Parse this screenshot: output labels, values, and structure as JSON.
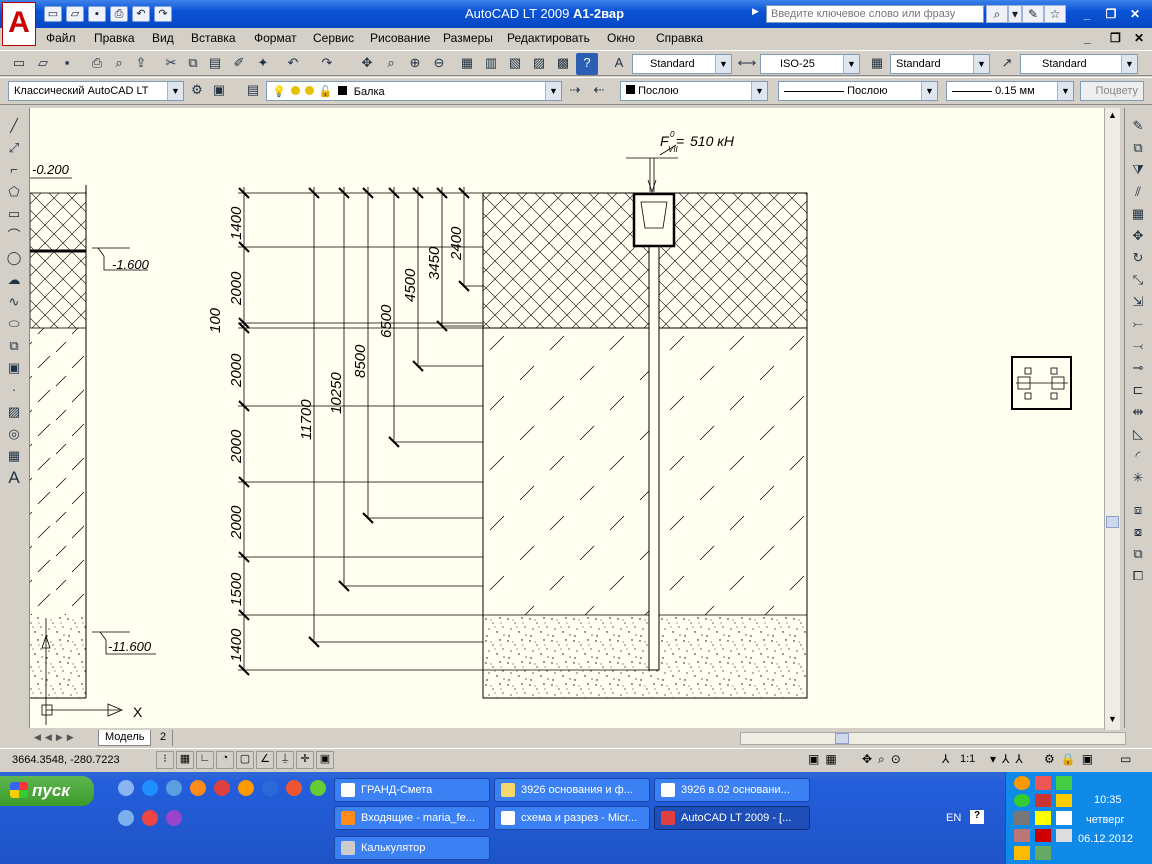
{
  "window": {
    "app": "AutoCAD LT 2009",
    "doc": "A1-2вар",
    "search_placeholder": "Введите ключевое слово или фразу"
  },
  "menu": [
    "Файл",
    "Правка",
    "Вид",
    "Вставка",
    "Формат",
    "Сервис",
    "Рисование",
    "Размеры",
    "Редактировать",
    "Окно",
    "Справка"
  ],
  "styles": {
    "text": "Standard",
    "dim": "ISO-25",
    "table": "Standard",
    "mleader": "Standard"
  },
  "workspace": "Классический AutoCAD LT",
  "layer": "Балка",
  "props": {
    "color": "Послою",
    "linetype": "Послою",
    "lineweight": "0.15 мм",
    "plotstyle": "Поцвету"
  },
  "drawing": {
    "force": "510 кН",
    "force_sym": "F",
    "force_sup": "0",
    "force_sub": "VII",
    "levels": [
      "-0.200",
      "-1.600",
      "-11.600"
    ],
    "layer_dims": [
      "1400",
      "2000",
      "100",
      "2000",
      "2000",
      "2000",
      "1500",
      "1400"
    ],
    "depth_dims": [
      "11700",
      "10250",
      "8500",
      "6500",
      "4500",
      "3450",
      "2400"
    ],
    "axis_x": "X"
  },
  "tabs": {
    "model": "Модель",
    "sheet": "2"
  },
  "status": {
    "coords": "3664.3548, -280.7223",
    "scale": "1:1"
  },
  "taskbar": {
    "start": "пуск",
    "tasks": [
      "ГРАНД-Смета",
      "3926 основания и ф...",
      "3926 в.02 основани...",
      "Входящие - maria_fe...",
      "схема и разрез - Micr...",
      "AutoCAD LT 2009 - [...",
      "Калькулятор"
    ],
    "lang": "EN",
    "time": "10:35",
    "day": "четверг",
    "date": "06.12.2012"
  }
}
